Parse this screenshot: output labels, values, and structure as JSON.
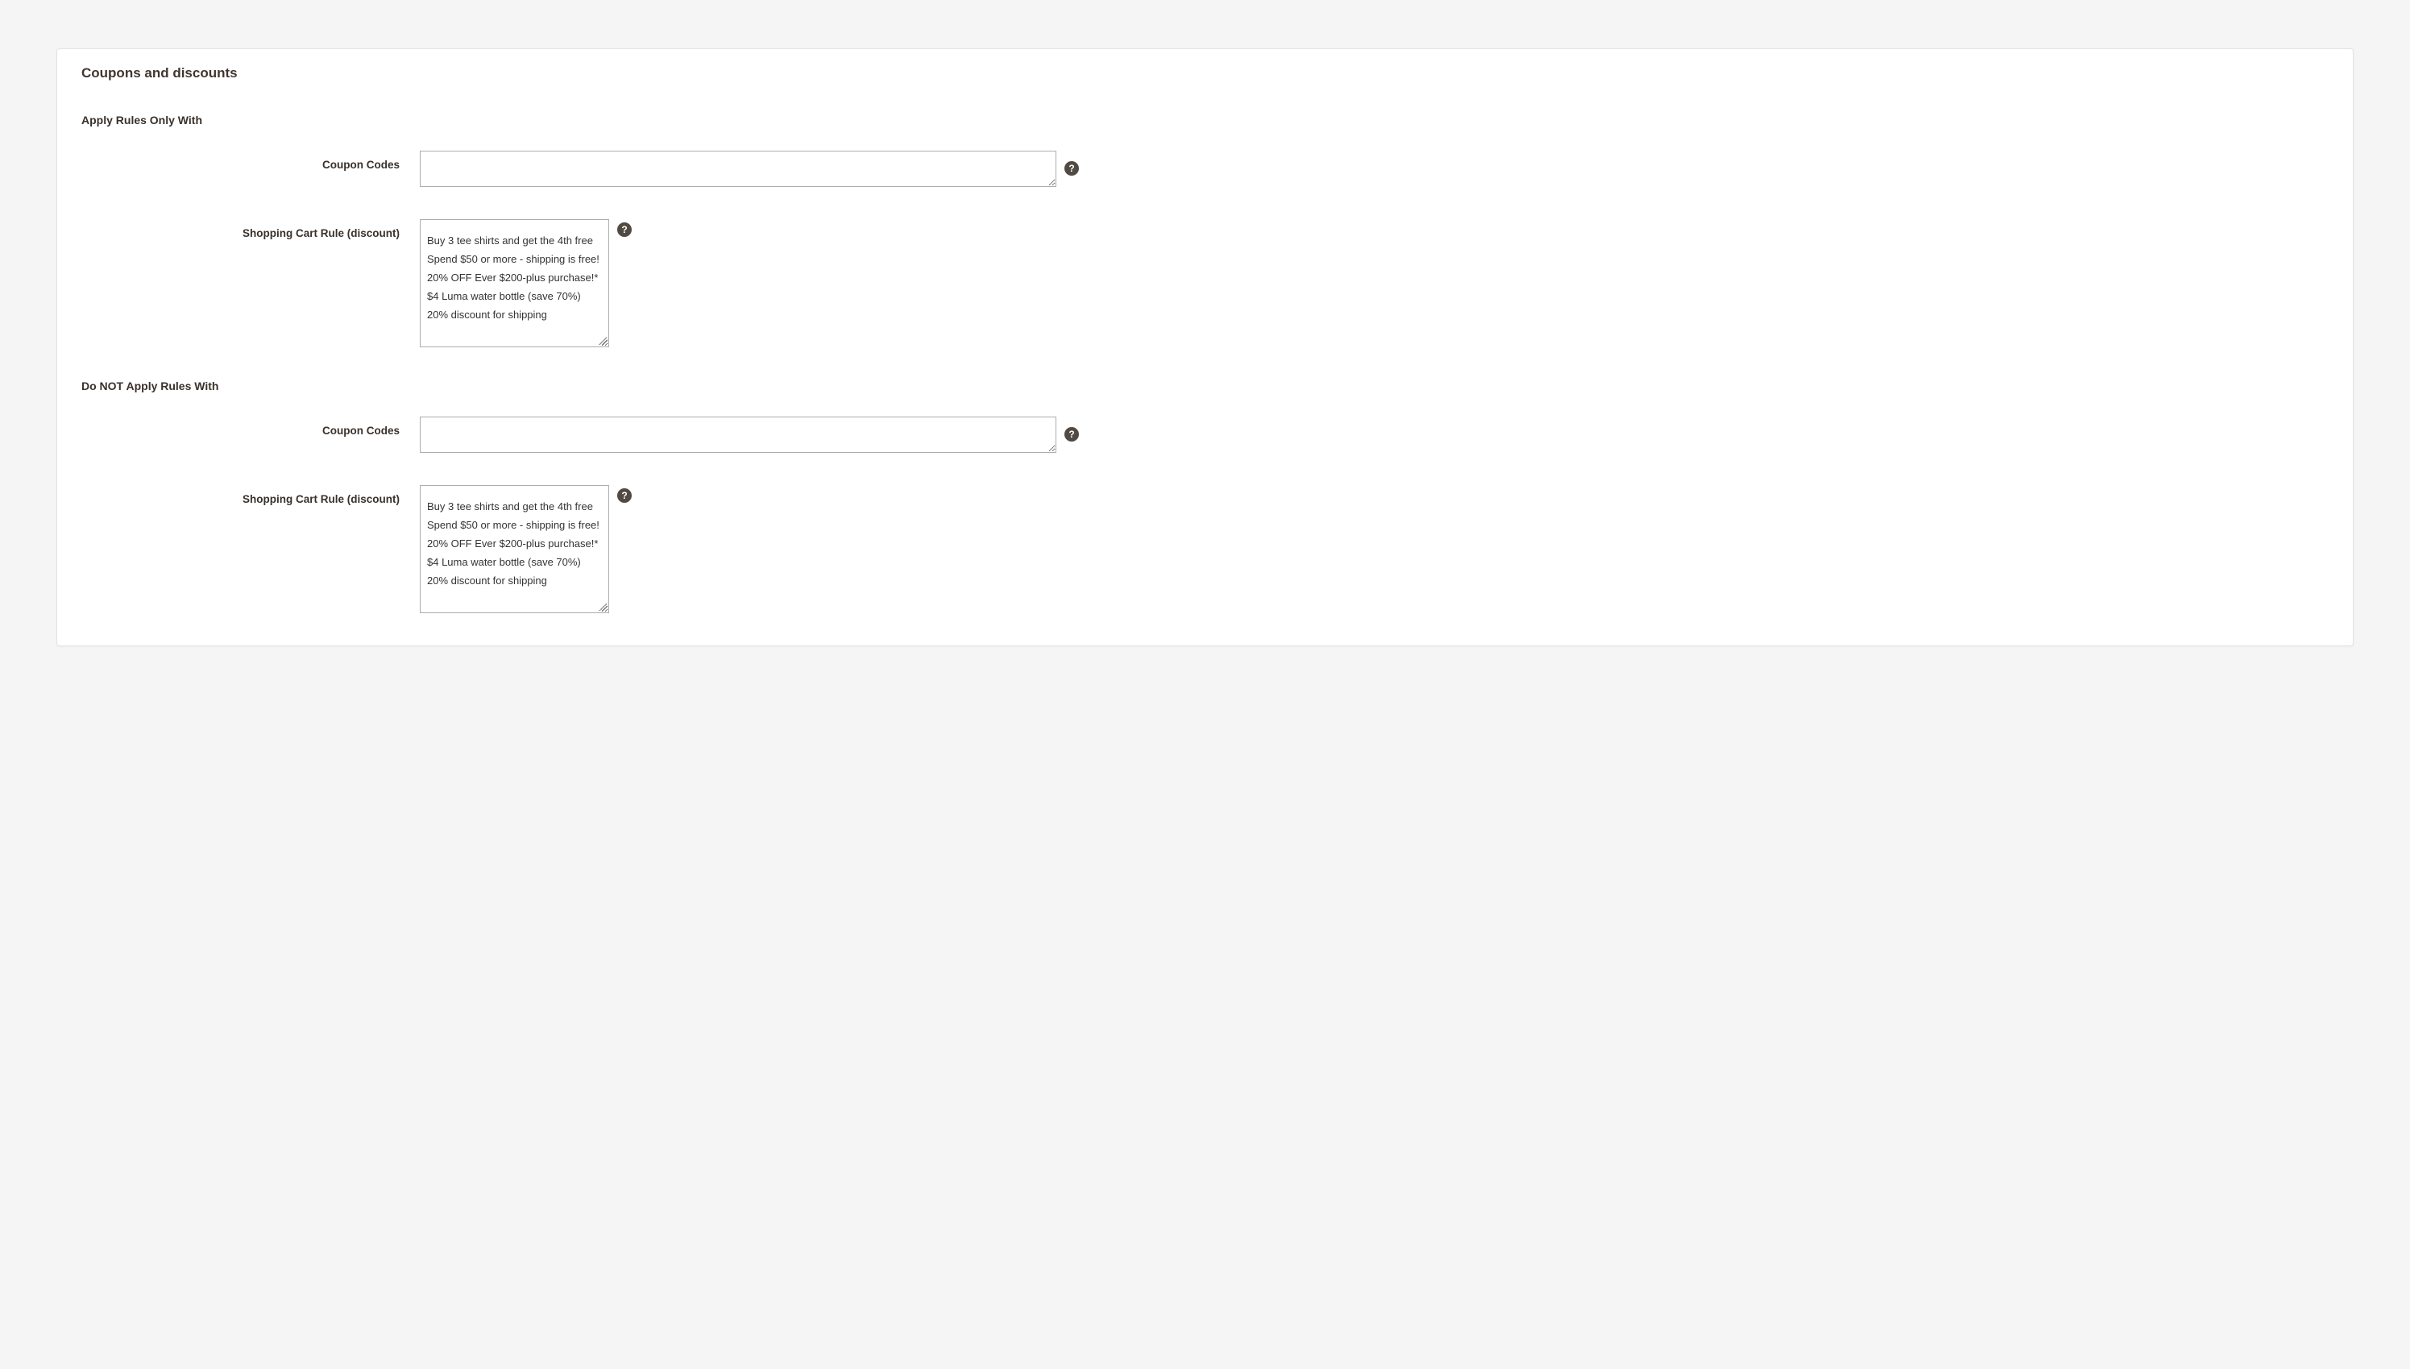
{
  "section_title": "Coupons and discounts",
  "apply_only": {
    "heading": "Apply Rules Only With",
    "coupon_codes_label": "Coupon Codes",
    "coupon_codes_value": "",
    "cart_rule_label": "Shopping Cart Rule (discount)",
    "cart_rule_options": [
      "Buy 3 tee shirts and get the 4th free",
      "Spend $50 or more - shipping is free!",
      "20% OFF Ever $200-plus purchase!*",
      "$4 Luma water bottle (save 70%)",
      "20% discount for shipping"
    ]
  },
  "do_not_apply": {
    "heading": "Do NOT Apply Rules With",
    "coupon_codes_label": "Coupon Codes",
    "coupon_codes_value": "",
    "cart_rule_label": "Shopping Cart Rule (discount)",
    "cart_rule_options": [
      "Buy 3 tee shirts and get the 4th free",
      "Spend $50 or more - shipping is free!",
      "20% OFF Ever $200-plus purchase!*",
      "$4 Luma water bottle (save 70%)",
      "20% discount for shipping"
    ]
  },
  "help_glyph": "?"
}
